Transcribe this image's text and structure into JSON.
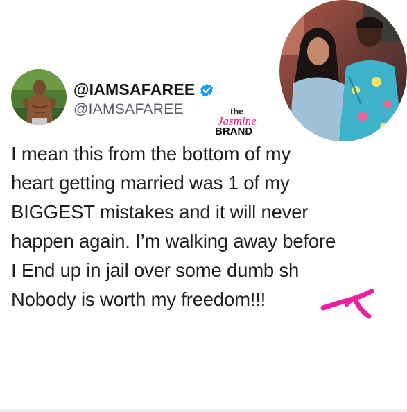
{
  "profile": {
    "display_name": "@IAMSAFAREE",
    "handle": "@IAMSAFAREE",
    "verified": true,
    "verified_icon": "verified-badge-icon",
    "verified_color": "#1d9bf0"
  },
  "watermark": {
    "line1": "the",
    "line2": "Jasmine",
    "line3": "BRAND",
    "accent_color": "#e8177d"
  },
  "tweet": {
    "lines": [
      "I mean this from the bottom of my",
      "heart getting married was 1 of my",
      "BIGGEST mistakes and it will never",
      "happen again. I’m walking away before",
      "I End up in jail over some dumb sh",
      "Nobody is worth my freedom!!!"
    ],
    "censor_color": "#ec1fa0"
  }
}
